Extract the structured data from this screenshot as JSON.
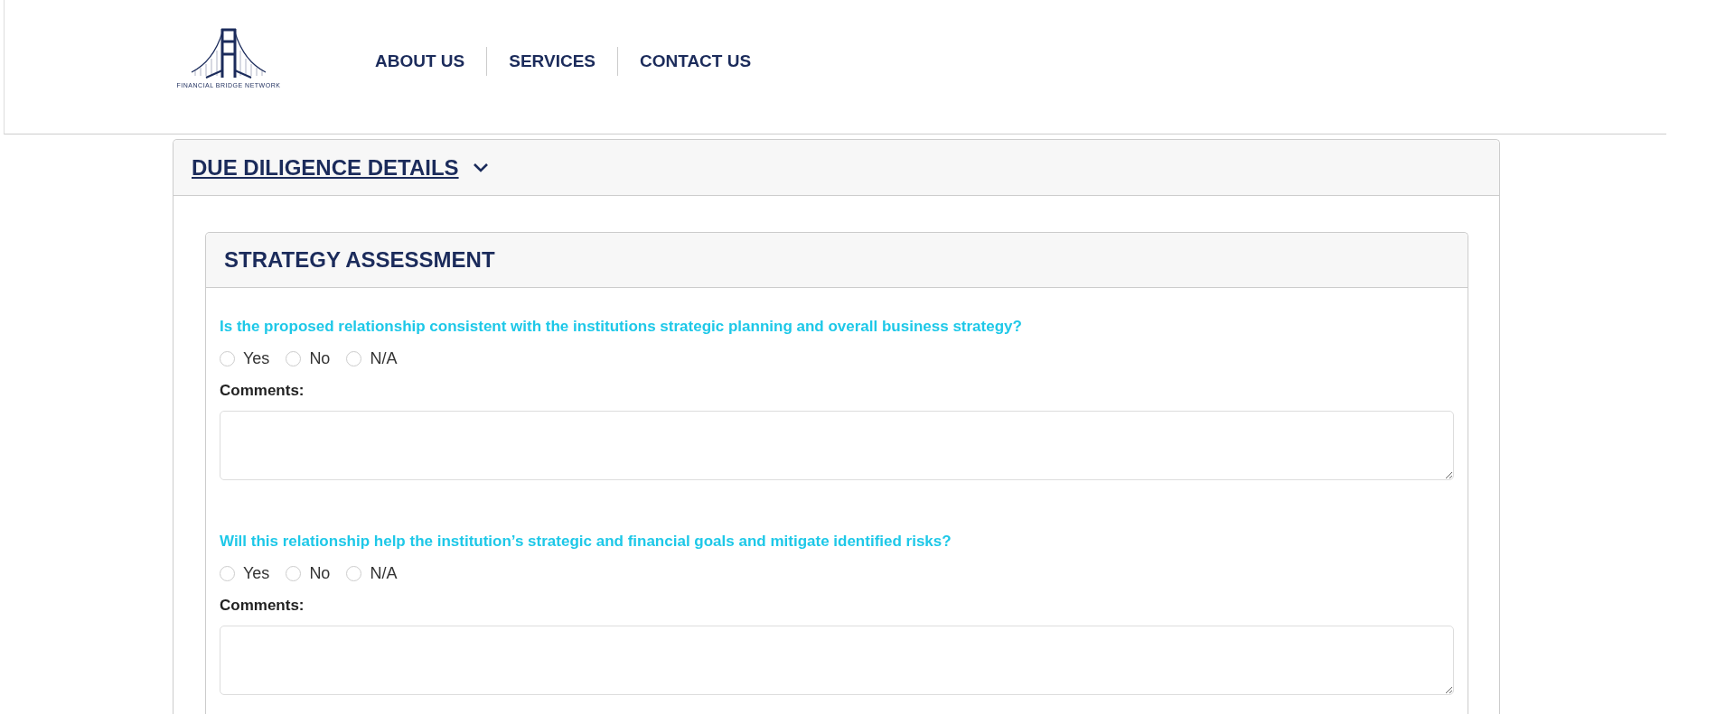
{
  "logo": {
    "text": "FINANCIAL BRIDGE NETWORK"
  },
  "nav": [
    {
      "label": "ABOUT US"
    },
    {
      "label": "SERVICES"
    },
    {
      "label": "CONTACT US"
    }
  ],
  "section": {
    "title": "DUE DILIGENCE DETAILS",
    "expanded": true,
    "panel": {
      "title": "STRATEGY ASSESSMENT",
      "questions": [
        {
          "text": "Is the proposed relationship consistent with the institutions strategic planning and overall business strategy?",
          "options": [
            {
              "label": "Yes",
              "selected": false
            },
            {
              "label": "No",
              "selected": false
            },
            {
              "label": "N/A",
              "selected": false
            }
          ],
          "comments_label": "Comments:"
        },
        {
          "text": "Will this relationship help the institution’s strategic and financial goals and mitigate identified risks?",
          "options": [
            {
              "label": "Yes",
              "selected": false
            },
            {
              "label": "No",
              "selected": false
            },
            {
              "label": "N/A",
              "selected": false
            }
          ],
          "comments_label": "Comments:"
        }
      ]
    }
  }
}
